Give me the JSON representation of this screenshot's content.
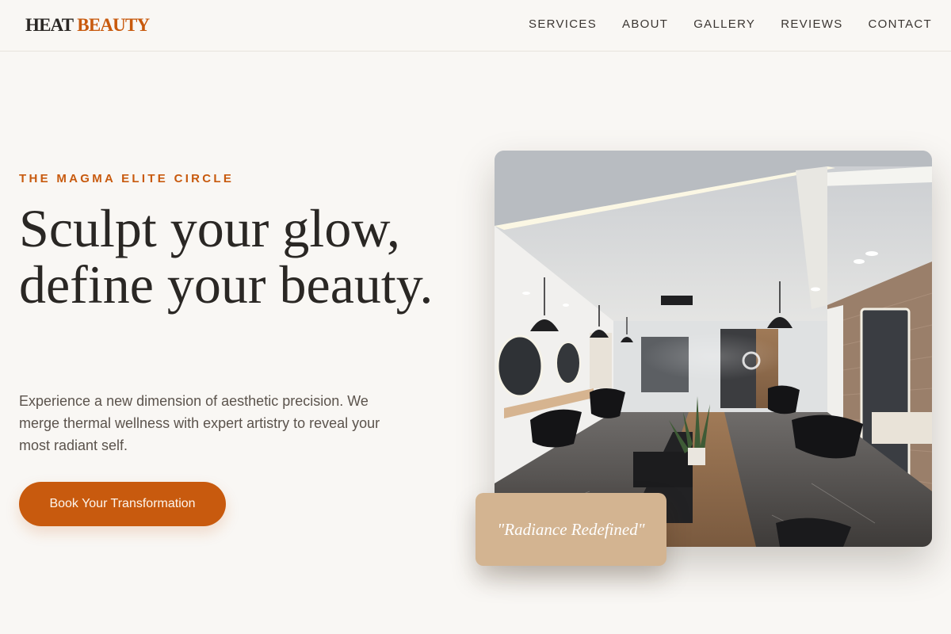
{
  "brand": {
    "part1": "HEAT",
    "part2": "BEAUTY",
    "accent_color": "#c85a0e"
  },
  "nav": {
    "items": [
      "SERVICES",
      "ABOUT",
      "GALLERY",
      "REVIEWS",
      "CONTACT"
    ]
  },
  "hero": {
    "eyebrow": "THE MAGMA ELITE CIRCLE",
    "headline": "Sculpt your glow, define your beauty.",
    "lead": "Experience a new dimension of aesthetic precision. We merge thermal wellness with expert artistry to reveal your most radiant self.",
    "cta_label": "Book Your Transformation"
  },
  "image": {
    "description_icon": "salon-interior-photo"
  },
  "quote": {
    "text": "\"Radiance Redefined\"",
    "card_color": "#d3b491"
  }
}
